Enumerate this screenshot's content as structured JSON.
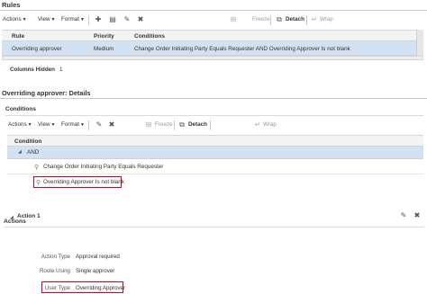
{
  "rules": {
    "heading": "Rules",
    "toolbar": {
      "actions": "Actions",
      "view": "View",
      "format": "Format",
      "freeze": "Freeze",
      "detach": "Detach",
      "wrap": "Wrap"
    },
    "columns": [
      "Rule",
      "Priority",
      "Conditions"
    ],
    "rows": [
      {
        "rule": "Overriding approver",
        "priority": "Medium",
        "conditions": "Change Order Initiating Party Equals Requester AND Overriding Approver Is not blank"
      }
    ],
    "columns_hidden_label": "Columns Hidden",
    "columns_hidden_count": "1"
  },
  "details": {
    "heading": "Overriding approver: Details",
    "conditions": {
      "heading": "Conditions",
      "toolbar": {
        "actions": "Actions",
        "view": "View",
        "format": "Format",
        "freeze": "Freeze",
        "detach": "Detach",
        "wrap": "Wrap"
      },
      "column": "Condition",
      "group": "AND",
      "items": [
        "Change Order Initiating Party Equals Requester",
        "Overriding Approver Is not blank"
      ]
    }
  },
  "actions": {
    "heading": "Actions",
    "action_title": "Action 1",
    "fields": [
      {
        "label": "Action Type",
        "value": "Approval required"
      },
      {
        "label": "Route Using",
        "value": "Single approver"
      },
      {
        "label": "User Type",
        "value": "Overriding Approver"
      }
    ]
  },
  "colors": {
    "selected_row": "#d3e2f2",
    "highlight_box": "#d2001e",
    "header_bg": "#f3f3f3"
  },
  "icons": [
    "add-icon",
    "table-icon",
    "edit-icon",
    "delete-icon",
    "freeze-icon",
    "detach-icon",
    "wrap-icon",
    "expand-icon",
    "condition-icon",
    "collapse-icon"
  ]
}
